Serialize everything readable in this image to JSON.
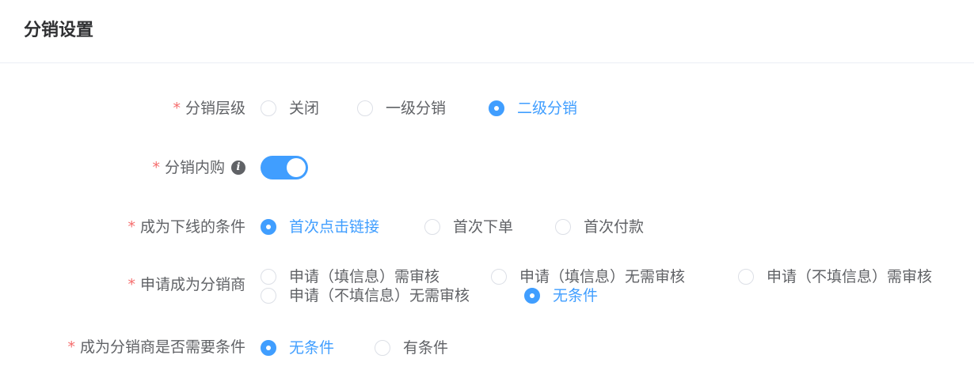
{
  "page": {
    "title": "分销设置"
  },
  "required_mark": "*",
  "level": {
    "label": "分销层级",
    "options": [
      "关闭",
      "一级分销",
      "二级分销"
    ],
    "selected": "二级分销"
  },
  "self_purchase": {
    "label": "分销内购",
    "info_glyph": "i",
    "enabled": true
  },
  "downline_condition": {
    "label": "成为下线的条件",
    "options": [
      "首次点击链接",
      "首次下单",
      "首次付款"
    ],
    "selected": "首次点击链接"
  },
  "apply_distributor": {
    "label": "申请成为分销商",
    "options": [
      "申请（填信息）需审核",
      "申请（填信息）无需审核",
      "申请（不填信息）需审核",
      "申请（不填信息）无需审核",
      "无条件"
    ],
    "selected": "无条件"
  },
  "need_condition": {
    "label": "成为分销商是否需要条件",
    "options": [
      "无条件",
      "有条件"
    ],
    "selected": "无条件"
  },
  "colors": {
    "primary": "#409eff",
    "required": "#f56c6c",
    "text": "#606266",
    "title": "#303133"
  }
}
